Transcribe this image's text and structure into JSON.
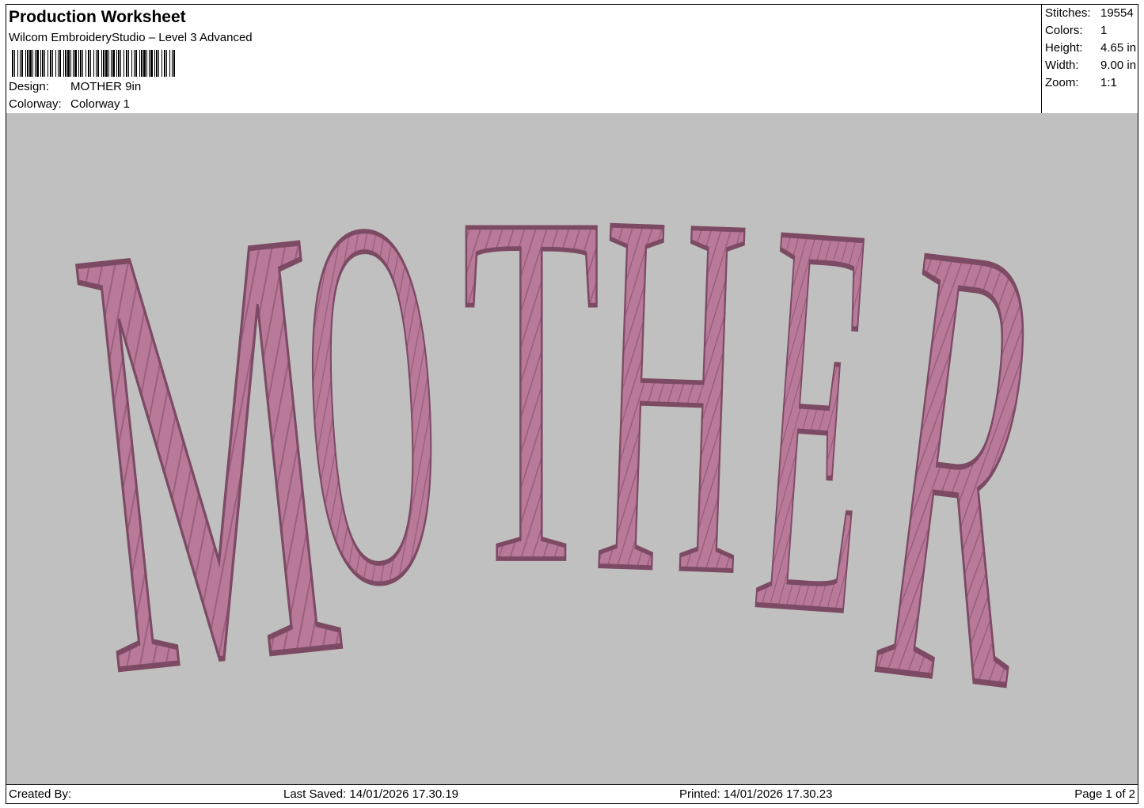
{
  "header": {
    "title": "Production Worksheet",
    "software": "Wilcom EmbroideryStudio – Level 3 Advanced",
    "design_label": "Design:",
    "design_value": "MOTHER 9in",
    "colorway_label": "Colorway:",
    "colorway_value": "Colorway 1"
  },
  "stats": {
    "stitches_label": "Stitches:",
    "stitches_value": "19554",
    "colors_label": "Colors:",
    "colors_value": "1",
    "height_label": "Height:",
    "height_value": "4.65 in",
    "width_label": "Width:",
    "width_value": "9.00 in",
    "zoom_label": "Zoom:",
    "zoom_value": "1:1"
  },
  "design": {
    "text": "MOTHER",
    "thread_color": "#b87a98",
    "thread_dark": "#7d4a63",
    "background": "#c0c0c0"
  },
  "footer": {
    "created_by": "Created By:",
    "last_saved": "Last Saved: 14/01/2026 17.30.19",
    "printed": "Printed: 14/01/2026 17.30.23",
    "page": "Page 1 of 2"
  }
}
